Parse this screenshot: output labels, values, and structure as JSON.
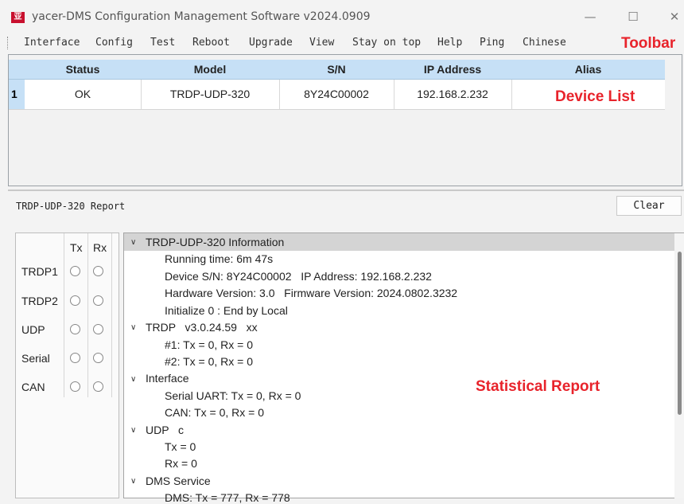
{
  "window": {
    "title": "yacer-DMS Configuration Management Software v2024.0909",
    "logo_text": "亚",
    "minimize": "—",
    "maximize": "☐",
    "close": "✕"
  },
  "menu": [
    "Interface",
    "Config",
    "Test",
    "Reboot",
    "Upgrade",
    "View",
    "Stay on top",
    "Help",
    "Ping",
    "Chinese"
  ],
  "annotations": {
    "toolbar": "Toolbar",
    "device_list": "Device List",
    "statistical_report": "Statistical Report"
  },
  "device_table": {
    "columns": [
      "Status",
      "Model",
      "S/N",
      "IP Address",
      "Alias"
    ],
    "rows": [
      {
        "index": "1",
        "status": "OK",
        "model": "TRDP-UDP-320",
        "sn": "8Y24C00002",
        "ip": "192.168.2.232",
        "alias": ""
      }
    ]
  },
  "report": {
    "title": "TRDP-UDP-320 Report",
    "clear_label": "Clear"
  },
  "txrx": {
    "tx_label": "Tx",
    "rx_label": "Rx",
    "rows": [
      "TRDP1",
      "TRDP2",
      "UDP",
      "Serial",
      "CAN"
    ]
  },
  "tree": [
    {
      "text": "TRDP-UDP-320 Information",
      "level": 0,
      "expanded": true,
      "selected": true
    },
    {
      "text": "Running time: 6m 47s",
      "level": 1
    },
    {
      "text": "Device S/N: 8Y24C00002   IP Address: 192.168.2.232",
      "level": 1
    },
    {
      "text": "Hardware Version: 3.0   Firmware Version: 2024.0802.3232",
      "level": 1
    },
    {
      "text": "Initialize 0 : End by Local",
      "level": 1
    },
    {
      "text": "TRDP   v3.0.24.59   xx",
      "level": 0,
      "expanded": true
    },
    {
      "text": "#1: Tx = 0, Rx = 0",
      "level": 1
    },
    {
      "text": "#2: Tx = 0, Rx = 0",
      "level": 1
    },
    {
      "text": "Interface",
      "level": 0,
      "expanded": true
    },
    {
      "text": "Serial UART: Tx = 0, Rx = 0",
      "level": 1
    },
    {
      "text": "CAN: Tx = 0, Rx = 0",
      "level": 1
    },
    {
      "text": "UDP   c",
      "level": 0,
      "expanded": true
    },
    {
      "text": "Tx = 0",
      "level": 1
    },
    {
      "text": "Rx = 0",
      "level": 1
    },
    {
      "text": "DMS Service",
      "level": 0,
      "expanded": true
    },
    {
      "text": "DMS: Tx = 777, Rx = 778",
      "level": 1
    }
  ],
  "colors": {
    "accent_annotation": "#e8232b",
    "grid_header": "#c6e0f6",
    "tree_selection": "#d4d4d4"
  }
}
